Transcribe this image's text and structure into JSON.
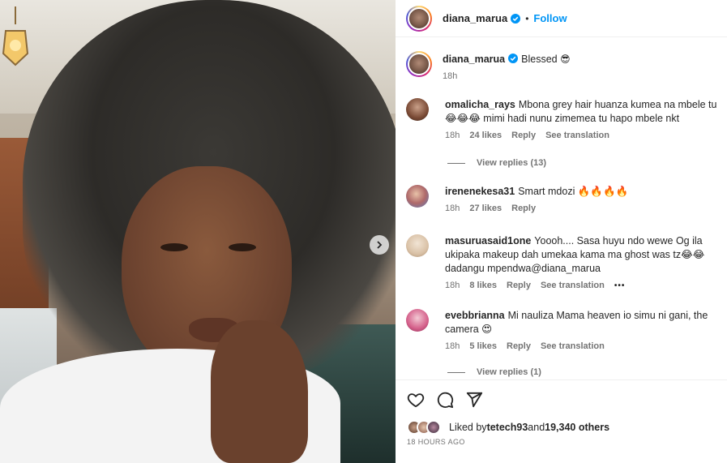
{
  "post": {
    "image_alt_semantic": "selfie-photo",
    "carousel_next_icon": "chevron-right-icon"
  },
  "header": {
    "username": "diana_marua",
    "separator": "•",
    "follow_label": "Follow"
  },
  "caption": {
    "username": "diana_marua",
    "text": "Blessed",
    "emoji": "😎",
    "time": "18h"
  },
  "comments": [
    {
      "username": "omalicha_rays",
      "text": "Mbona grey hair huanza kumea na mbele tu😂😂😂 mimi hadi nunu zimemea tu hapo mbele nkt",
      "time": "18h",
      "likes": "24 likes",
      "reply": "Reply",
      "translate": "See translation",
      "view_replies": "View replies (13)"
    },
    {
      "username": "irenenekesa31",
      "text": "Smart mdozi 🔥🔥🔥🔥",
      "time": "18h",
      "likes": "27 likes",
      "reply": "Reply"
    },
    {
      "username": "masuruasaid1one",
      "text": "Yoooh.... Sasa huyu ndo wewe Og ila ukipaka makeup dah umekaa kama ma ghost was tz😂😂 dadangu mpendwa@diana_marua",
      "time": "18h",
      "likes": "8 likes",
      "reply": "Reply",
      "translate": "See translation",
      "more": "•••"
    },
    {
      "username": "evebbrianna",
      "text": "Mi nauliza Mama heaven io simu ni gani, the camera 😍",
      "time": "18h",
      "likes": "5 likes",
      "reply": "Reply",
      "translate": "See translation",
      "view_replies": "View replies (1)"
    }
  ],
  "footer": {
    "liked_prefix": "Liked by ",
    "liked_user": "tetech93",
    "liked_mid": " and ",
    "liked_count": "19,340 others",
    "timestamp": "18 HOURS AGO"
  },
  "colors": {
    "accent": "#0095f6",
    "text": "#262626",
    "secondary": "#737373",
    "divider": "#efefef"
  }
}
